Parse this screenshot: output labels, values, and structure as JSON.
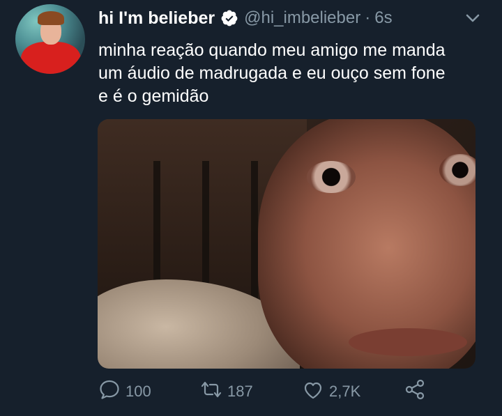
{
  "tweet": {
    "display_name": "hi I'm belieber",
    "handle": "@hi_imbelieber",
    "separator": "·",
    "time": "6s",
    "text_lines": [
      "minha reação quando meu amigo me manda",
      "um áudio de madrugada e eu ouço sem fone",
      "e é o gemidão"
    ],
    "verified": true
  },
  "actions": {
    "reply_count": "100",
    "retweet_count": "187",
    "like_count": "2,7K"
  },
  "icons": {
    "avatar": "avatar",
    "verified": "verified-badge-icon",
    "more": "chevron-down-icon",
    "reply": "reply-icon",
    "retweet": "retweet-icon",
    "like": "heart-icon",
    "share": "share-icon"
  },
  "colors": {
    "background": "#16202c",
    "text": "#ffffff",
    "secondary": "#8899a6"
  }
}
